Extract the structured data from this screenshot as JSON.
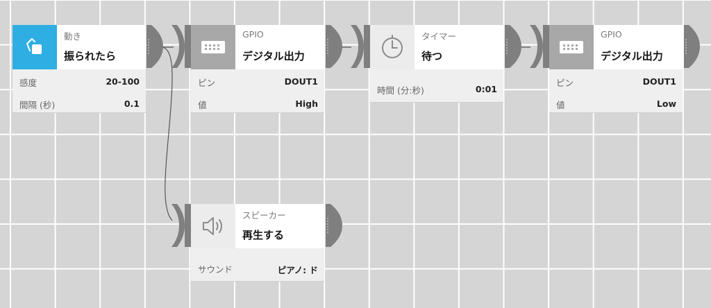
{
  "colors": {
    "accent_blue": "#2eaee2",
    "icon_gray": "#a8a8a8",
    "connector_gray": "#7f7f7f",
    "background": "#d5d5d5",
    "grid_line": "#ffffff"
  },
  "blocks": {
    "motion": {
      "icon": "shake-icon",
      "category": "動き",
      "name": "振られたら",
      "props": [
        {
          "label": "感度",
          "value": "20-100"
        },
        {
          "label": "間隔 (秒)",
          "value": "0.1"
        }
      ]
    },
    "gpio1": {
      "icon": "gpio-board-icon",
      "category": "GPIO",
      "name": "デジタル出力",
      "props": [
        {
          "label": "ピン",
          "value": "DOUT1"
        },
        {
          "label": "値",
          "value": "High"
        }
      ]
    },
    "timer": {
      "icon": "clock-icon",
      "category": "タイマー",
      "name": "待つ",
      "props": [
        {
          "label": "時間 (分:秒)",
          "value": "0:01"
        }
      ]
    },
    "gpio2": {
      "icon": "gpio-board-icon",
      "category": "GPIO",
      "name": "デジタル出力",
      "props": [
        {
          "label": "ピン",
          "value": "DOUT1"
        },
        {
          "label": "値",
          "value": "Low"
        }
      ]
    },
    "speaker": {
      "icon": "speaker-icon",
      "category": "スピーカー",
      "name": "再生する",
      "props": [
        {
          "label": "サウンド",
          "value": "ピアノ: ド"
        }
      ]
    }
  }
}
